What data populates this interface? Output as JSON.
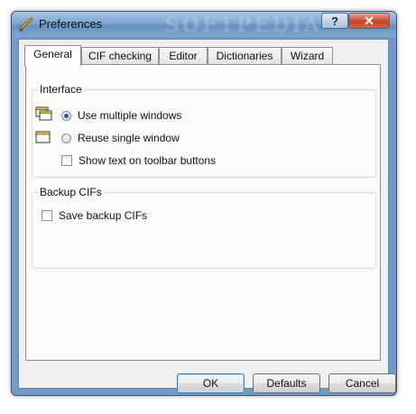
{
  "window": {
    "title": "Preferences",
    "help_label": "?",
    "close_label": "✕"
  },
  "watermark": "SOFTPEDIA",
  "tabs": [
    {
      "label": "General",
      "active": true
    },
    {
      "label": "CIF checking",
      "active": false
    },
    {
      "label": "Editor",
      "active": false
    },
    {
      "label": "Dictionaries",
      "active": false
    },
    {
      "label": "Wizard",
      "active": false
    }
  ],
  "interface": {
    "group_label": "Interface",
    "use_multiple_windows": {
      "label": "Use multiple windows",
      "selected": true
    },
    "reuse_single_window": {
      "label": "Reuse single window",
      "selected": false
    },
    "show_text_toolbar": {
      "label": "Show text on toolbar buttons",
      "checked": false
    }
  },
  "backup": {
    "group_label": "Backup CIFs",
    "save_backup": {
      "label": "Save backup CIFs",
      "checked": false
    }
  },
  "buttons": {
    "ok": "OK",
    "defaults": "Defaults",
    "cancel": "Cancel"
  },
  "icons": {
    "app": "brush-icon",
    "multi": "multiple-windows-icon",
    "single": "single-window-icon"
  }
}
